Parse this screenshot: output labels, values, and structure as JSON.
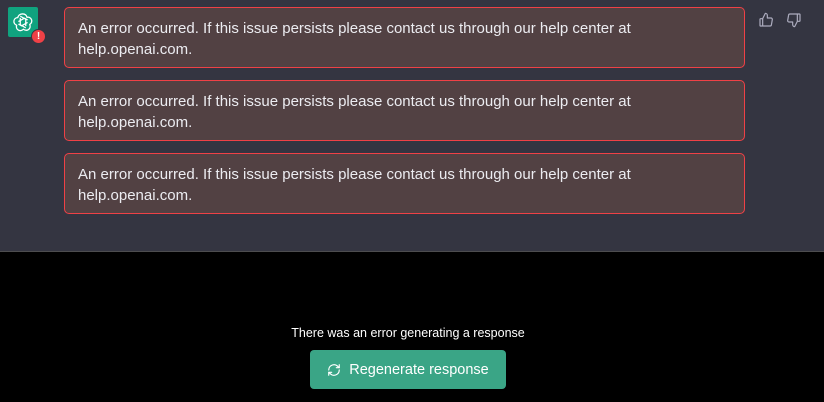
{
  "assistant": {
    "avatar_icon": "openai-logo-icon",
    "avatar_color": "#10a37f",
    "error_badge": "!"
  },
  "messages": [
    {
      "text": "An error occurred. If this issue persists please contact us through our help center at help.openai.com."
    },
    {
      "text": "An error occurred. If this issue persists please contact us through our help center at help.openai.com."
    },
    {
      "text": "An error occurred. If this issue persists please contact us through our help center at help.openai.com."
    }
  ],
  "feedback": {
    "up_icon": "thumbs-up-icon",
    "down_icon": "thumbs-down-icon"
  },
  "footer": {
    "error_text": "There was an error generating a response",
    "regenerate_label": "Regenerate response",
    "regenerate_icon": "refresh-icon",
    "accent_color": "#10a37f",
    "error_color": "#ef4146"
  }
}
